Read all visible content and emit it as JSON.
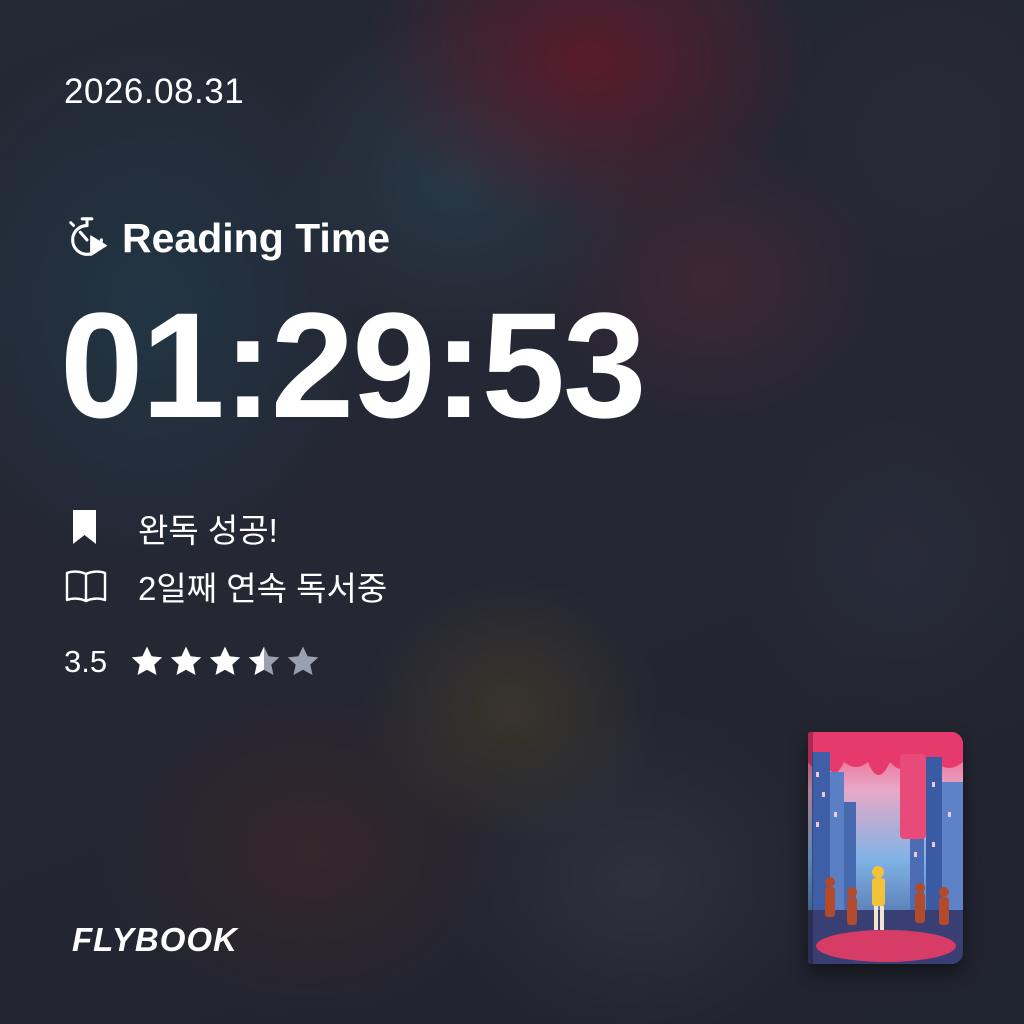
{
  "date": "2026.08.31",
  "reading_time": {
    "icon": "timer-play-icon",
    "label": "Reading Time",
    "value": "01:29:53"
  },
  "status": [
    {
      "icon": "bookmark-icon",
      "text": "완독 성공!"
    },
    {
      "icon": "open-book-icon",
      "text": "2일째 연속 독서중"
    }
  ],
  "rating": {
    "value_text": "3.5",
    "value": 3.5,
    "max": 5
  },
  "brand": {
    "logo": "FLYBOOK"
  },
  "colors": {
    "text": "#ffffff",
    "star_filled": "#ffffff",
    "star_empty": "#9aa0b0"
  }
}
